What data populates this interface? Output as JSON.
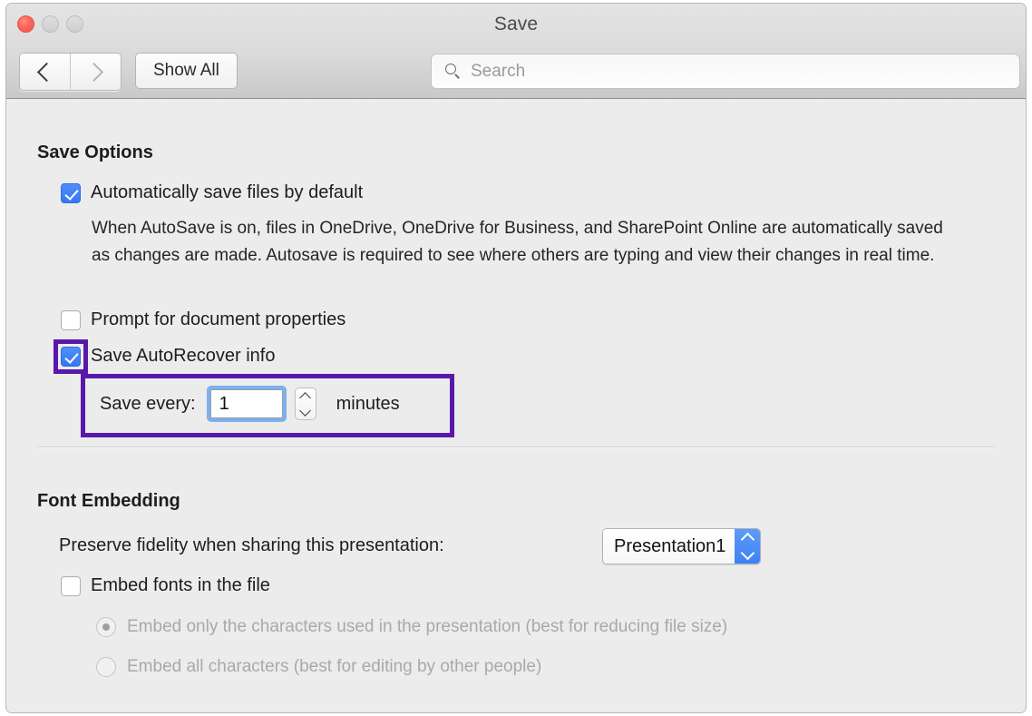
{
  "window": {
    "title": "Save",
    "traffic_lights": [
      "close-button",
      "minimize-button",
      "zoom-button"
    ]
  },
  "toolbar": {
    "back_label": "‹",
    "forward_label": "›",
    "show_all_label": "Show All",
    "search_placeholder": "Search",
    "search_value": ""
  },
  "save_options": {
    "heading": "Save Options",
    "auto_save": {
      "label": "Automatically save files by default",
      "checked": true
    },
    "auto_save_description": "When AutoSave is on, files in OneDrive, OneDrive for Business, and SharePoint Online are automatically saved as changes are made. Autosave is required to see where others are typing and view their changes in real time.",
    "prompt_properties": {
      "label": "Prompt for document properties",
      "checked": false
    },
    "autorecover": {
      "label": "Save AutoRecover info",
      "checked": true
    },
    "save_every": {
      "label": "Save every:",
      "value": "1",
      "unit": "minutes"
    }
  },
  "font_embedding": {
    "heading": "Font Embedding",
    "preserve_label": "Preserve fidelity when sharing this presentation:",
    "preserve_value": "Presentation1",
    "embed_fonts": {
      "label": "Embed fonts in the file",
      "checked": false
    },
    "radios": [
      {
        "label": "Embed only the characters used in the presentation (best for reducing file size)",
        "selected": true,
        "disabled": true
      },
      {
        "label": "Embed all characters (best for editing by other people)",
        "selected": false,
        "disabled": true
      }
    ]
  },
  "annotations": {
    "highlight_color": "#5a18ab",
    "boxes": [
      "autorecover-checkbox-highlight",
      "save-every-row-highlight"
    ]
  },
  "colors": {
    "accent_blue": "#3478f6",
    "window_bg": "#ececec",
    "toolbar_bg": "#dadada",
    "highlight_purple": "#5a18ab",
    "focus_ring": "#7cb0ee"
  }
}
